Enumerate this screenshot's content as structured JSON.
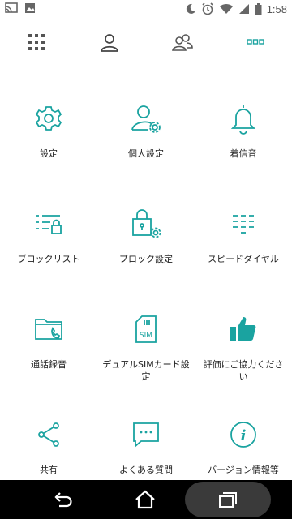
{
  "status_bar": {
    "time": "1:58",
    "left_icons": [
      "cast-icon",
      "image-icon"
    ],
    "right_icons": [
      "moon-icon",
      "alarm-icon",
      "wifi-icon",
      "signal-icon",
      "battery-icon"
    ]
  },
  "tabs": [
    {
      "icon": "dialpad-grid-icon"
    },
    {
      "icon": "person-icon"
    },
    {
      "icon": "group-icon"
    },
    {
      "icon": "more-dots-icon",
      "active": true
    }
  ],
  "accent_color": "#1aa3a0",
  "menu": [
    {
      "label": "設定",
      "icon": "gear-icon"
    },
    {
      "label": "個人設定",
      "icon": "person-settings-icon"
    },
    {
      "label": "着信音",
      "icon": "bell-icon"
    },
    {
      "label": "ブロックリスト",
      "icon": "block-list-icon"
    },
    {
      "label": "ブロック設定",
      "icon": "lock-settings-icon"
    },
    {
      "label": "スピードダイヤル",
      "icon": "speed-dial-icon"
    },
    {
      "label": "通話録音",
      "icon": "call-recording-folder-icon"
    },
    {
      "label": "デュアルSIMカード設定",
      "icon": "sim-card-icon"
    },
    {
      "label": "評価にご協力ください",
      "icon": "thumbs-up-icon"
    },
    {
      "label": "共有",
      "icon": "share-icon"
    },
    {
      "label": "よくある質問",
      "icon": "faq-chat-icon"
    },
    {
      "label": "バージョン情報等",
      "icon": "info-icon"
    }
  ],
  "nav_bar": [
    "back-icon",
    "home-icon",
    "recent-apps-icon"
  ]
}
